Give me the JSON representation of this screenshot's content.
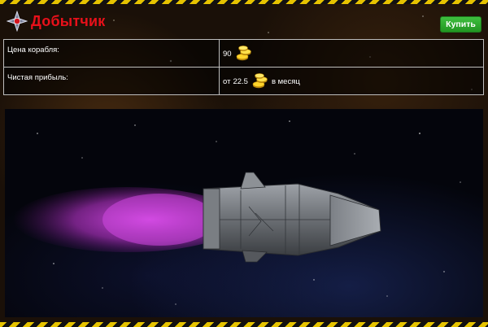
{
  "header": {
    "title": "Добытчик",
    "buy_label": "Купить"
  },
  "info": {
    "rows": [
      {
        "label": "Цена корабля:",
        "value": "90",
        "unit": ""
      },
      {
        "label": "Чистая прибыль:",
        "prefix": "от",
        "value": "22.5",
        "unit": "в месяц"
      }
    ]
  },
  "icons": {
    "logo": "emblem-icon",
    "coin": "gold-coins-icon",
    "ship": "spaceship-image"
  },
  "colors": {
    "title": "#e8101a",
    "button": "#2fa92f",
    "hazard_yellow": "#e6c300",
    "engine_glow": "#c030d0"
  }
}
